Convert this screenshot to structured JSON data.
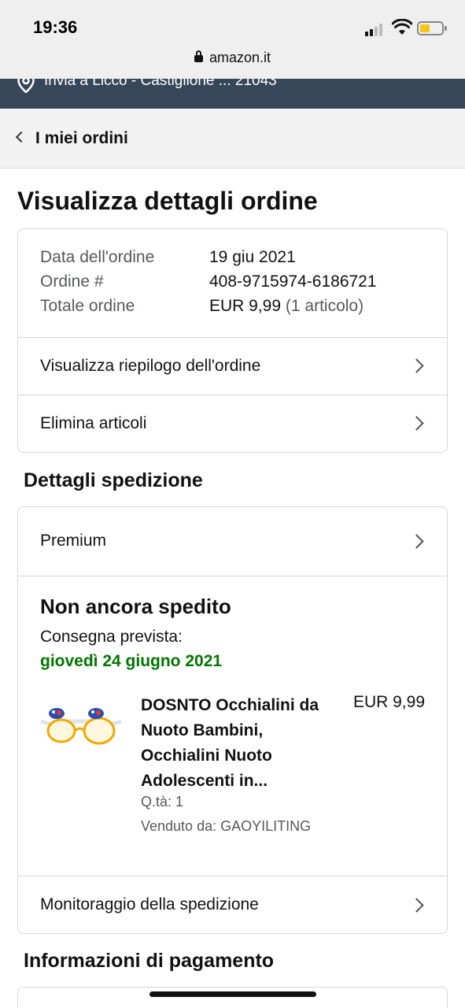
{
  "status_bar": {
    "time": "19:36",
    "url": "amazon.it",
    "battery_color": "#f5c518"
  },
  "delivery_bar": {
    "text": "Invia a Licco - Castiglione ... 21043",
    "icon": "location-pin-icon"
  },
  "nav": {
    "back_label": "I miei ordini"
  },
  "page": {
    "title": "Visualizza dettagli ordine"
  },
  "order_summary": {
    "date_label": "Data dell'ordine",
    "date_value": "19 giu 2021",
    "number_label": "Ordine #",
    "number_value": "408-9715974-6186721",
    "total_label": "Totale ordine",
    "total_value": "EUR 9,99",
    "total_items": "(1 articolo)",
    "links": [
      {
        "label": "Visualizza riepilogo dell'ordine"
      },
      {
        "label": "Elimina articoli"
      }
    ]
  },
  "shipping": {
    "section_title": "Dettagli spedizione",
    "service": "Premium",
    "status": "Non ancora spedito",
    "expected_label": "Consegna prevista:",
    "expected_date": "giovedì 24 giugno 2021",
    "expected_date_color": "#007600",
    "product": {
      "title": "DOSNTO Occhialini da Nuoto Bambini, Occhialini Nuoto Adolescenti in...",
      "price": "EUR 9,99",
      "qty": "Q.tà: 1",
      "seller": "Venduto da: GAOYILITING",
      "image": "swim-goggles-image"
    },
    "tracking_label": "Monitoraggio della spedizione"
  },
  "payment": {
    "section_title": "Informazioni di pagamento"
  }
}
